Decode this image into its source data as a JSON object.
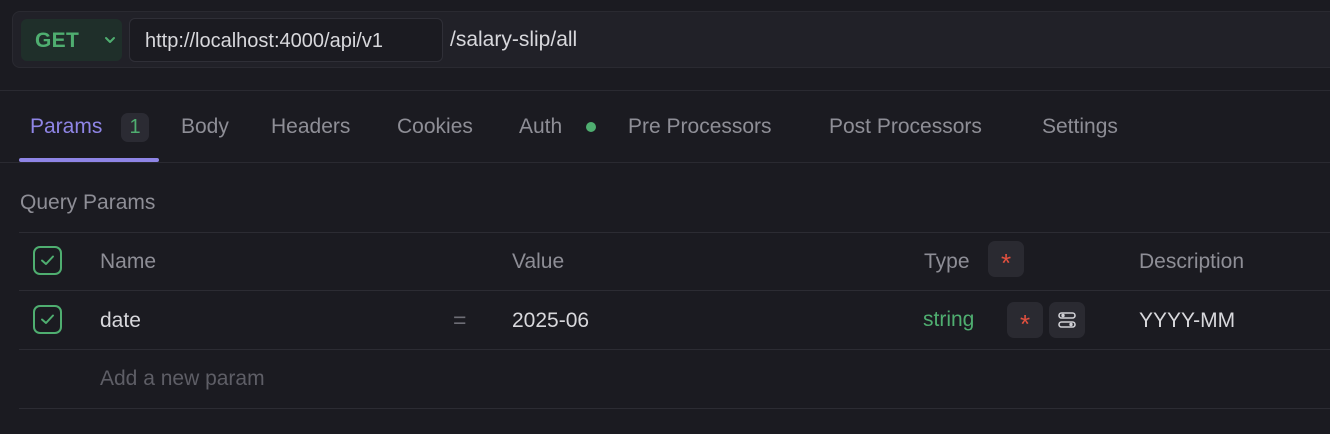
{
  "request": {
    "method": "GET",
    "base_url": "http://localhost:4000/api/v1",
    "path": "/salary-slip/all"
  },
  "tabs": [
    {
      "label": "Params",
      "badge": "1",
      "active": true
    },
    {
      "label": "Body"
    },
    {
      "label": "Headers"
    },
    {
      "label": "Cookies"
    },
    {
      "label": "Auth",
      "indicator": "green-dot"
    },
    {
      "label": "Pre Processors"
    },
    {
      "label": "Post Processors"
    },
    {
      "label": "Settings"
    }
  ],
  "query_params": {
    "title": "Query Params",
    "columns": {
      "name": "Name",
      "value": "Value",
      "type": "Type",
      "description": "Description"
    },
    "required_marker": "*",
    "rows": [
      {
        "name": "date",
        "separator": "=",
        "value": "2025-06",
        "type": "string",
        "required_marker": "*",
        "description": "YYYY-MM",
        "enabled": true
      }
    ],
    "add_placeholder": "Add a new param"
  },
  "colors": {
    "accent": "#8f85e6",
    "success": "#4fae70",
    "required": "#e2503f",
    "background": "#1b1b21"
  },
  "icons": [
    "chevron-down-icon",
    "checkbox-icon",
    "settings-sliders-icon"
  ]
}
